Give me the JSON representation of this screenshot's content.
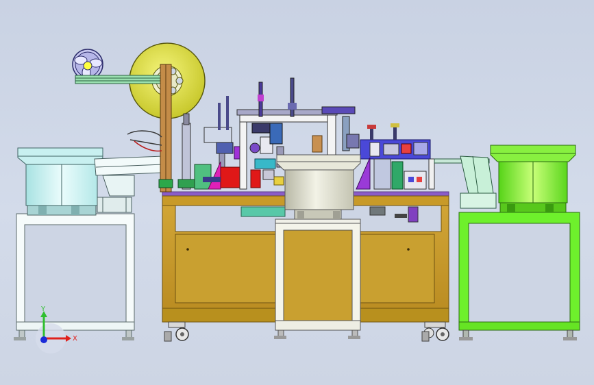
{
  "view": {
    "background_top": "#c9d2e3",
    "background_bottom": "#cdd5e4"
  },
  "triad": {
    "x_label": "X",
    "y_label": "Y",
    "x_color": "#e0201c",
    "y_color": "#2fbf2f",
    "z_color": "#1a2ad8"
  },
  "colors": {
    "frame_gold": "#c79b2b",
    "frame_gold_dark": "#8f6a12",
    "left_bowl": "#c8f2f2",
    "left_stand": "#f4fafa",
    "center_bowl": "#d8d8c8",
    "center_stand": "#f2f2ea",
    "right_bowl": "#7cf23a",
    "right_stand": "#6ef02c",
    "reel": "#e0e04c",
    "fan_reel": "#c8c8f0",
    "rail_green": "#8ed8a0",
    "tower_wood": "#c08a4a",
    "purple": "#8a2cc8",
    "magenta": "#d020b0",
    "red": "#e01818",
    "blue_panel": "#4a48d8",
    "cyan": "#38b8c8"
  }
}
